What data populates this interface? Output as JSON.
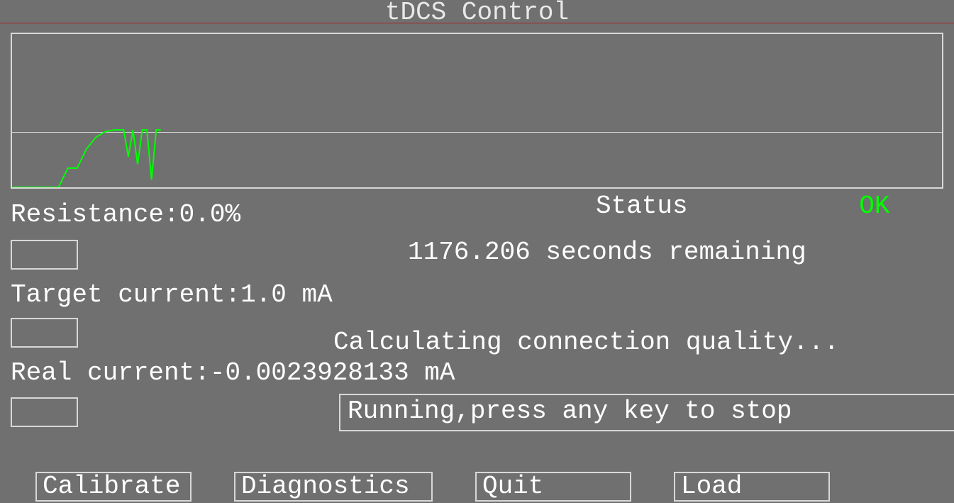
{
  "title": "tDCS Control",
  "chart_data": {
    "type": "line",
    "title": "",
    "xlabel": "",
    "ylabel": "",
    "x": [
      0,
      5,
      10,
      12,
      14,
      16,
      18,
      20,
      22,
      24,
      25,
      26,
      27,
      28,
      29,
      30,
      31,
      32
    ],
    "values": [
      0,
      0,
      0,
      0.5,
      0.5,
      1.0,
      1.3,
      1.45,
      1.5,
      1.5,
      0.8,
      1.5,
      0.6,
      1.5,
      1.5,
      0.2,
      1.5,
      1.5
    ],
    "midline_y": 1.5,
    "ylim": [
      0,
      4
    ],
    "xlim": [
      0,
      200
    ],
    "color": "#00ff00"
  },
  "resistance": {
    "label": "Resistance:",
    "value": "0.0%"
  },
  "status": {
    "label": "Status",
    "value": "OK"
  },
  "remaining": {
    "value": "1176.206",
    "suffix": " seconds remaining"
  },
  "target_current": {
    "label": "Target current:",
    "value": "1.0 mA"
  },
  "real_current": {
    "label": "Real current:",
    "value": "-0.0023928133 mA"
  },
  "calculating_msg": "Calculating connection quality...",
  "running_msg": "Running,press any key to stop",
  "buttons": {
    "calibrate": "Calibrate",
    "diagnostics": "Diagnostics",
    "quit": "Quit",
    "load": "Load"
  },
  "colors": {
    "ok": "#00ff00",
    "bg": "#707070",
    "border": "#d8d8d8"
  }
}
